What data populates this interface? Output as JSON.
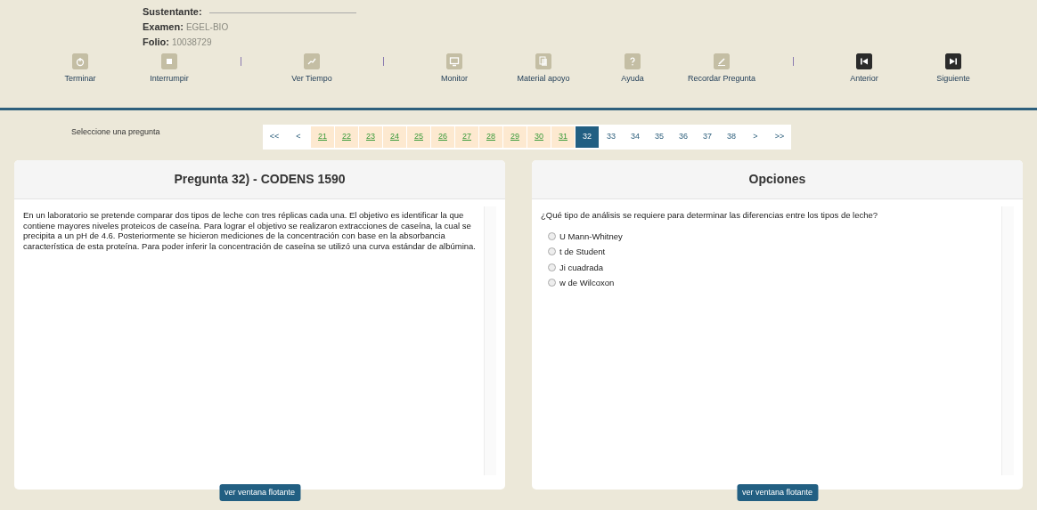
{
  "header": {
    "sustentante_label": "Sustentante:",
    "examen_label": "Examen:",
    "examen_value": "EGEL-BIO",
    "folio_label": "Folio:",
    "folio_value": "10038729"
  },
  "toolbar": [
    {
      "kind": "button",
      "label": "Terminar",
      "enabled": false
    },
    {
      "kind": "button",
      "label": "Interrumpir",
      "enabled": false
    },
    {
      "kind": "separator"
    },
    {
      "kind": "button",
      "label": "Ver Tiempo",
      "enabled": false
    },
    {
      "kind": "separator"
    },
    {
      "kind": "button",
      "label": "Monitor",
      "enabled": false
    },
    {
      "kind": "button",
      "label": "Material apoyo",
      "enabled": false
    },
    {
      "kind": "button",
      "label": "Ayuda",
      "enabled": false
    },
    {
      "kind": "button",
      "label": "Recordar Pregunta",
      "enabled": false
    },
    {
      "kind": "separator"
    },
    {
      "kind": "button",
      "label": "Anterior",
      "enabled": true
    },
    {
      "kind": "button",
      "label": "Siguiente",
      "enabled": true
    }
  ],
  "pager": {
    "label": "Seleccione una pregunta",
    "items": [
      {
        "label": "<<",
        "answered": false,
        "selected": false
      },
      {
        "label": "<",
        "answered": false,
        "selected": false
      },
      {
        "label": "21",
        "answered": true,
        "selected": false
      },
      {
        "label": "22",
        "answered": true,
        "selected": false
      },
      {
        "label": "23",
        "answered": true,
        "selected": false
      },
      {
        "label": "24",
        "answered": true,
        "selected": false
      },
      {
        "label": "25",
        "answered": true,
        "selected": false
      },
      {
        "label": "26",
        "answered": true,
        "selected": false
      },
      {
        "label": "27",
        "answered": true,
        "selected": false
      },
      {
        "label": "28",
        "answered": true,
        "selected": false
      },
      {
        "label": "29",
        "answered": true,
        "selected": false
      },
      {
        "label": "30",
        "answered": true,
        "selected": false
      },
      {
        "label": "31",
        "answered": true,
        "selected": false
      },
      {
        "label": "32",
        "answered": false,
        "selected": true
      },
      {
        "label": "33",
        "answered": false,
        "selected": false
      },
      {
        "label": "34",
        "answered": false,
        "selected": false
      },
      {
        "label": "35",
        "answered": false,
        "selected": false
      },
      {
        "label": "36",
        "answered": false,
        "selected": false
      },
      {
        "label": "37",
        "answered": false,
        "selected": false
      },
      {
        "label": "38",
        "answered": false,
        "selected": false
      },
      {
        "label": ">",
        "answered": false,
        "selected": false
      },
      {
        "label": ">>",
        "answered": false,
        "selected": false
      }
    ]
  },
  "question_panel": {
    "title": "Pregunta 32) - CODENS 1590",
    "text": "En un laboratorio se pretende comparar dos tipos de leche con tres réplicas cada una. El objetivo es identificar la que contiene mayores niveles proteicos de caseína. Para lograr el objetivo se realizaron extracciones de caseína, la cual se precipita a un pH de 4.6. Posteriormente se hicieron mediciones de la concentración con base en la absorbancia característica de esta proteína. Para poder inferir la concentración de caseína se utilizó una curva estándar de albúmina.",
    "float_button": "ver ventana flotante"
  },
  "options_panel": {
    "title": "Opciones",
    "prompt": "¿Qué tipo de análisis se requiere para determinar las diferencias entre los tipos de leche?",
    "options": [
      {
        "label": "U Mann-Whitney",
        "selected": false
      },
      {
        "label": "t de Student",
        "selected": false
      },
      {
        "label": "Ji cuadrada",
        "selected": false
      },
      {
        "label": "w de Wilcoxon",
        "selected": false
      }
    ],
    "float_button": "ver ventana flotante"
  }
}
